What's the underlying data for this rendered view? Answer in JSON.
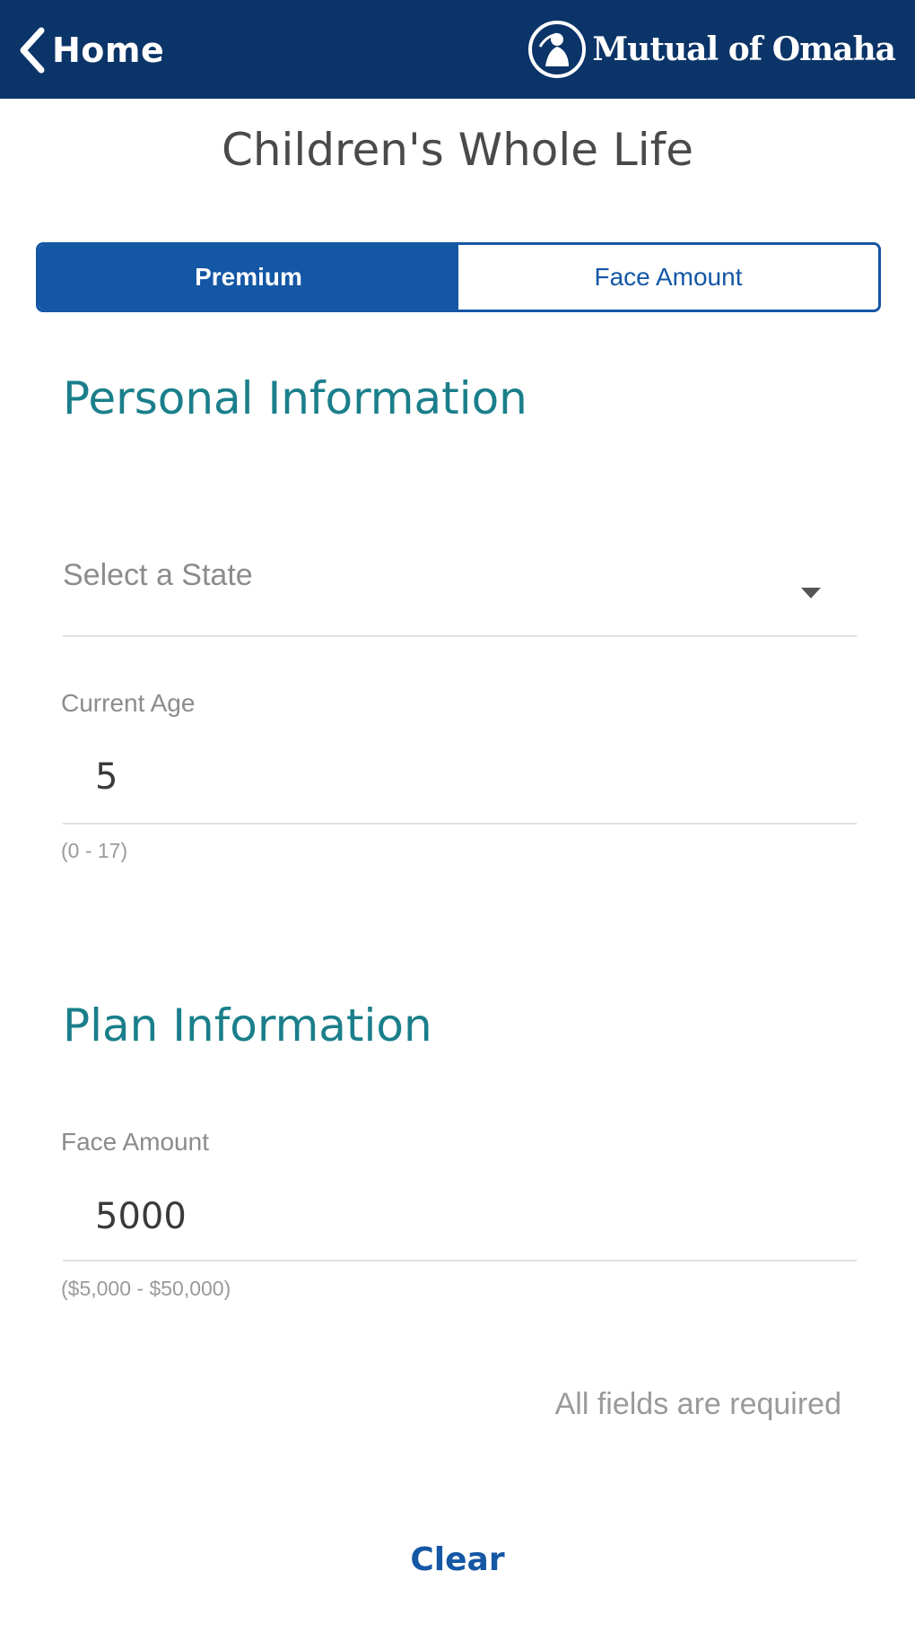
{
  "header": {
    "back_label": "Home",
    "brand": "Mutual of Omaha",
    "brand_color": "#0b3468",
    "icons": [
      "chevron-left-icon",
      "brand-logo-icon"
    ]
  },
  "page": {
    "title": "Children's Whole Life"
  },
  "segments": {
    "items": [
      {
        "label": "Premium",
        "active": true
      },
      {
        "label": "Face Amount",
        "active": false
      }
    ],
    "accent_color": "#1457a5"
  },
  "personal": {
    "title": "Personal Information",
    "state_placeholder": "Select a State",
    "age_label": "Current Age",
    "age_value": "5",
    "age_hint": "(0 - 17)"
  },
  "plan": {
    "title": "Plan Information",
    "face_label": "Face Amount",
    "face_value": "5000",
    "face_hint": "($5,000 - $50,000)"
  },
  "footer": {
    "required_note": "All fields are required",
    "clear_label": "Clear"
  }
}
